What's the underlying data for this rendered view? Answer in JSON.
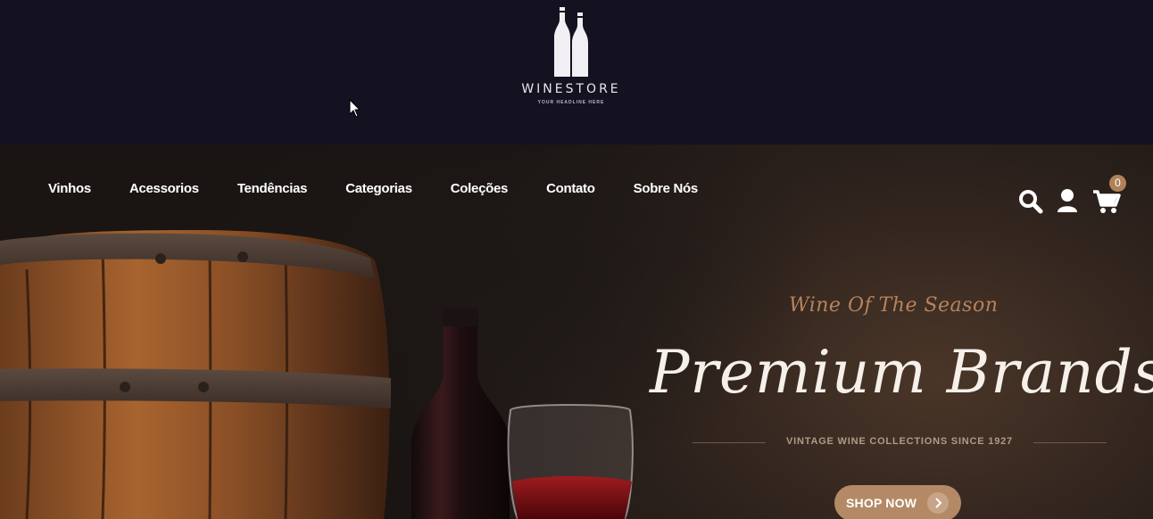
{
  "header": {
    "logo": {
      "name": "WINESTORE",
      "tagline": "YOUR HEADLINE HERE",
      "icon": "wine-bottles-icon"
    }
  },
  "nav": {
    "items": [
      {
        "label": "Vinhos"
      },
      {
        "label": "Acessorios"
      },
      {
        "label": "Tendências"
      },
      {
        "label": "Categorias"
      },
      {
        "label": "Coleções"
      },
      {
        "label": "Contato"
      },
      {
        "label": "Sobre Nós"
      }
    ],
    "icons": {
      "search": "search-icon",
      "account": "user-icon",
      "cart": "cart-icon"
    },
    "cart_count": "0"
  },
  "hero": {
    "script_title": "Wine Of The Season",
    "title": "Premium Brands",
    "subtitle": "VINTAGE WINE COLLECTIONS SINCE 1927",
    "cta_label": "SHOP NOW",
    "cta_icon": "chevron-right-icon"
  },
  "colors": {
    "header_bg": "#141120",
    "accent": "#b08259",
    "nav_text": "#ffffff"
  }
}
